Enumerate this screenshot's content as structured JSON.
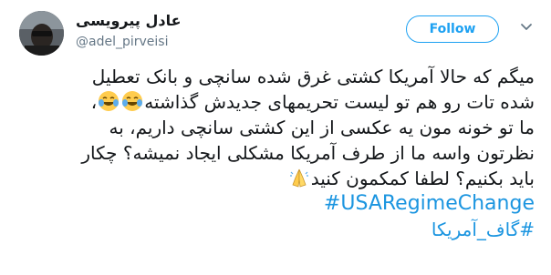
{
  "tweet": {
    "author_name": "عادل پیرویسی",
    "author_handle": "@adel_pirveisi",
    "follow_label": "Follow",
    "lines": [
      "میگم که حالا آمریکا کشتی غرق شده سانچی و بانک تعطیل",
      "شده تات رو هم تو لیست تحریمهای جدیدش گذاشته",
      "ما تو خونه مون یه عکسی از این کشتی سانچی داریم، به",
      "نظرتون واسه ما از طرف آمریکا مشکلی ایجاد نمیشه؟ چکار",
      "باید بکنیم؟ لطفا کمکمون کنید"
    ],
    "hashtags": [
      "#USARegimeChange",
      "#گاف_آمریکا"
    ],
    "icons": {
      "laughing": "face-with-tears-of-joy-icon",
      "pray": "folded-hands-icon",
      "menu": "chevron-down-icon"
    },
    "colors": {
      "link": "#1b95e0",
      "follow": "#1da1f2",
      "text": "#14171a",
      "muted": "#657786"
    }
  }
}
